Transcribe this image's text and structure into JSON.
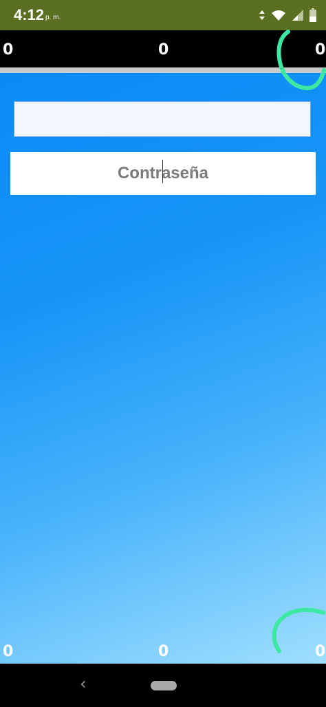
{
  "status_bar": {
    "time": "4:12",
    "ampm": "p. m.",
    "icons": [
      "data-transfer-icon",
      "wifi-icon",
      "signal-icon",
      "battery-icon"
    ]
  },
  "scoreboard": {
    "top": {
      "left": "0",
      "center": "0",
      "right": "0"
    },
    "bottom": {
      "left": "0",
      "center": "0",
      "right": "0"
    }
  },
  "form": {
    "username": {
      "value": "",
      "placeholder": ""
    },
    "password": {
      "value": "",
      "placeholder": "Contraseña"
    }
  },
  "nav": {
    "back_label": "‹"
  },
  "colors": {
    "status_bar": "#5a6f22",
    "score_bar": "#000000",
    "gradient_top": "#0a8af7",
    "gradient_bottom": "#9fdffe",
    "arc_stroke": "#3de8a2"
  }
}
